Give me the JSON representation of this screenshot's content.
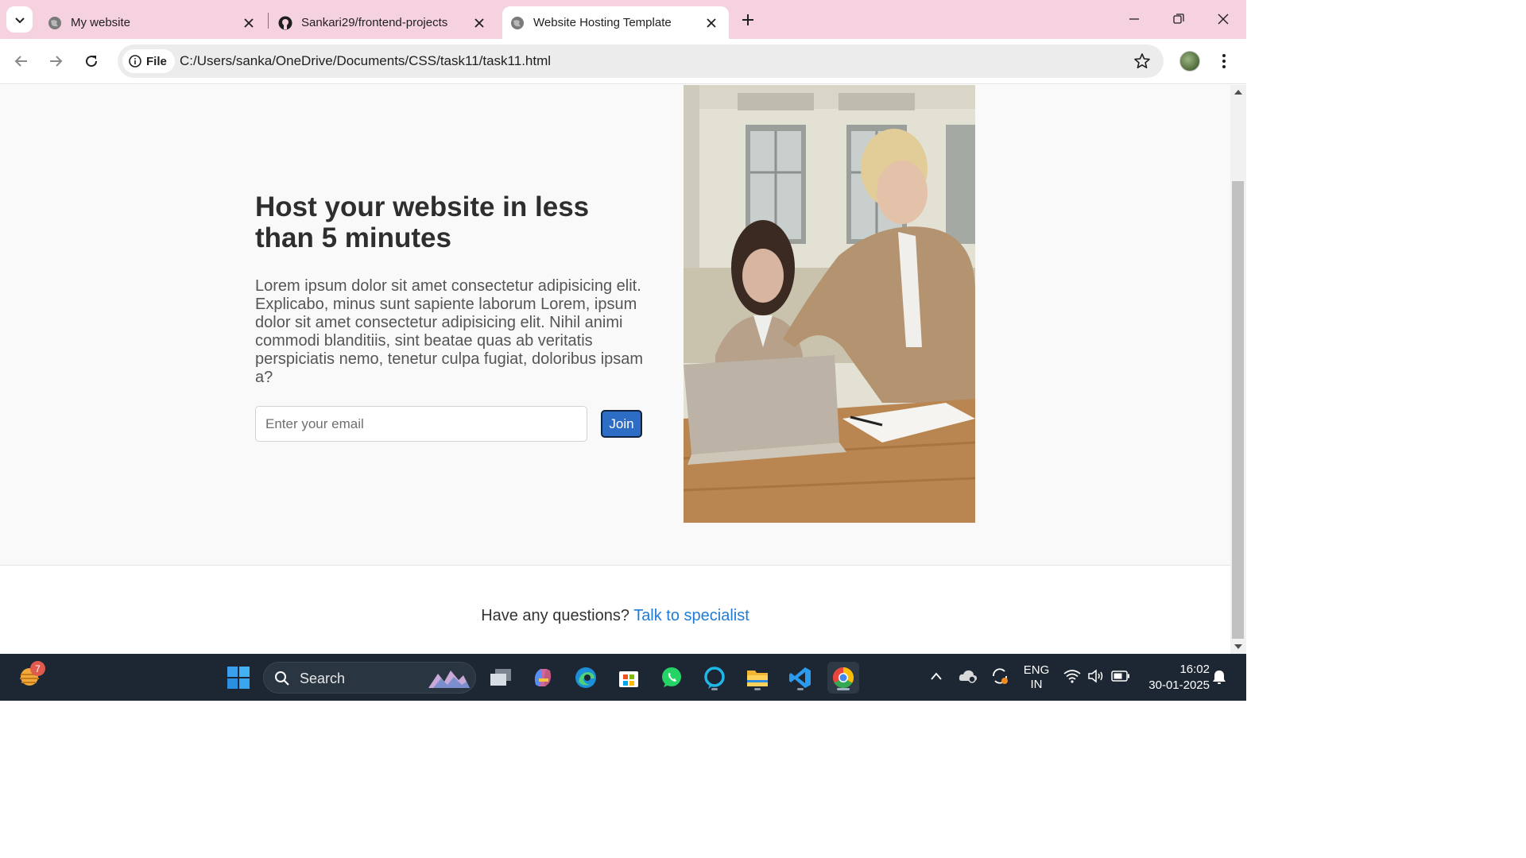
{
  "browser": {
    "tabs": [
      {
        "title": "My website"
      },
      {
        "title": "Sankari29/frontend-projects"
      },
      {
        "title": "Website Hosting Template"
      }
    ],
    "security_chip": "File",
    "url": "C:/Users/sanka/OneDrive/Documents/CSS/task11/task11.html"
  },
  "page": {
    "heading": "Host your website in less than 5 minutes",
    "body": "Lorem ipsum dolor sit amet consectetur adipisicing elit. Explicabo, minus sunt sapiente laborum Lorem, ipsum dolor sit amet consectetur adipisicing elit. Nihil animi commodi blanditiis, sint beatae quas ab veritatis perspiciatis nemo, tenetur culpa fugiat, doloribus ipsam a?",
    "email_placeholder": "Enter your email",
    "join_label": "Join",
    "footer_question": "Have any questions?",
    "footer_link": "Talk to specialist"
  },
  "taskbar": {
    "weather_badge": "7",
    "search_label": "Search",
    "lang_line1": "ENG",
    "lang_line2": "IN",
    "time": "16:02",
    "date": "30-01-2025"
  },
  "colors": {
    "tabstrip": "#f6d2e1",
    "join_button": "#2d6dc6",
    "link": "#1f7bd6",
    "taskbar": "#1d2733"
  }
}
